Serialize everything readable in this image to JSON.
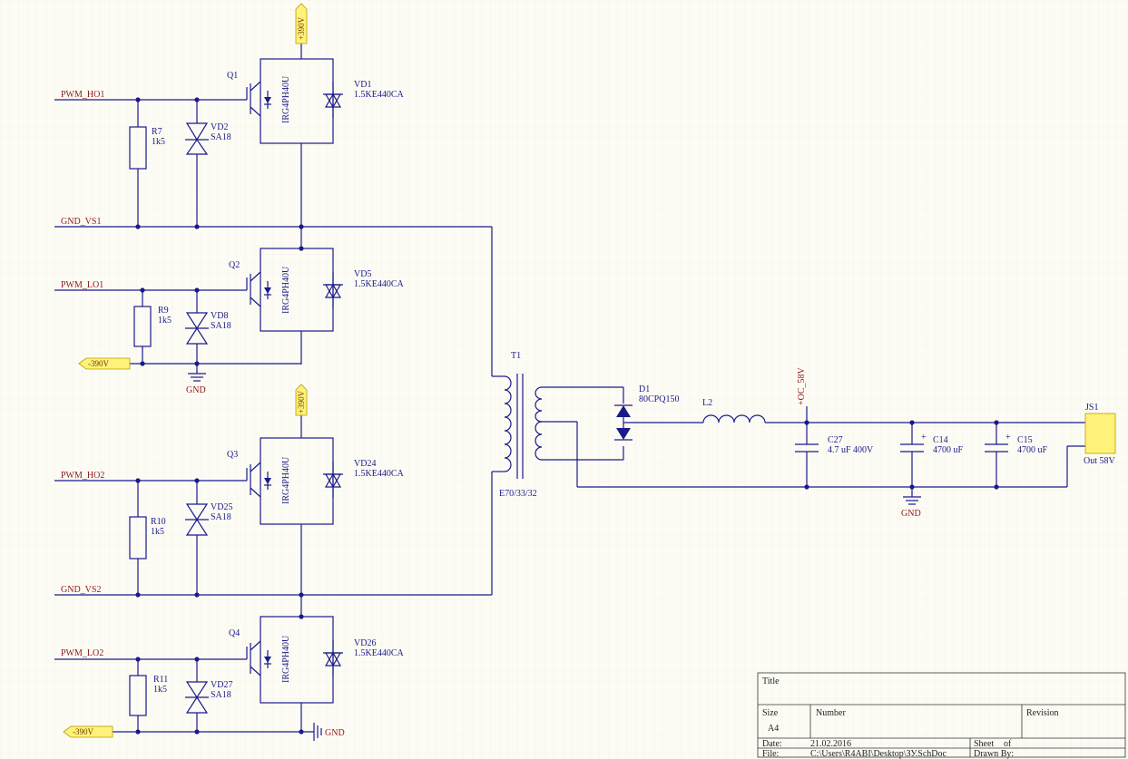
{
  "nets": {
    "pwm_ho1": "PWM_HO1",
    "pwm_lo1": "PWM_LO1",
    "pwm_ho2": "PWM_HO2",
    "pwm_lo2": "PWM_LO2",
    "gnd_vs1": "GND_VS1",
    "gnd_vs2": "GND_VS2",
    "plus390": "+390V",
    "minus390": "-390V",
    "gnd": "GND",
    "oc58": "+OC_58V"
  },
  "igbt": [
    {
      "ref": "Q1",
      "part": "IRG4PH40U"
    },
    {
      "ref": "Q2",
      "part": "IRG4PH40U"
    },
    {
      "ref": "Q3",
      "part": "IRG4PH40U"
    },
    {
      "ref": "Q4",
      "part": "IRG4PH40U"
    }
  ],
  "tvs_big": [
    {
      "ref": "VD1",
      "part": "1.5KE440CA"
    },
    {
      "ref": "VD5",
      "part": "1.5KE440CA"
    },
    {
      "ref": "VD24",
      "part": "1.5KE440CA"
    },
    {
      "ref": "VD26",
      "part": "1.5KE440CA"
    }
  ],
  "tvs_small": [
    {
      "ref": "VD2",
      "part": "SA18"
    },
    {
      "ref": "VD8",
      "part": "SA18"
    },
    {
      "ref": "VD25",
      "part": "SA18"
    },
    {
      "ref": "VD27",
      "part": "SA18"
    }
  ],
  "resistors": [
    {
      "ref": "R7",
      "value": "1k5"
    },
    {
      "ref": "R9",
      "value": "1k5"
    },
    {
      "ref": "R10",
      "value": "1k5"
    },
    {
      "ref": "R11",
      "value": "1k5"
    }
  ],
  "transformer": {
    "ref": "T1",
    "core": "E70/33/32"
  },
  "diode": {
    "ref": "D1",
    "part": "80CPQ150"
  },
  "inductor": {
    "ref": "L2"
  },
  "capacitors": [
    {
      "ref": "C27",
      "value": "4.7 uF 400V"
    },
    {
      "ref": "C14",
      "value": "4700 uF"
    },
    {
      "ref": "C15",
      "value": "4700 uF"
    }
  ],
  "connector": {
    "ref": "JS1",
    "label": "Out 58V"
  },
  "title_block": {
    "title_label": "Title",
    "size_label": "Size",
    "size_value": "A4",
    "number_label": "Number",
    "revision_label": "Revision",
    "date_label": "Date:",
    "date_value": "21.02.2016",
    "sheet_label": "Sheet",
    "of_label": "of",
    "file_label": "File:",
    "file_value": "C:\\Users\\R4ABI\\Desktop\\ЗУ.SchDoc",
    "drawn_label": "Drawn By:"
  }
}
